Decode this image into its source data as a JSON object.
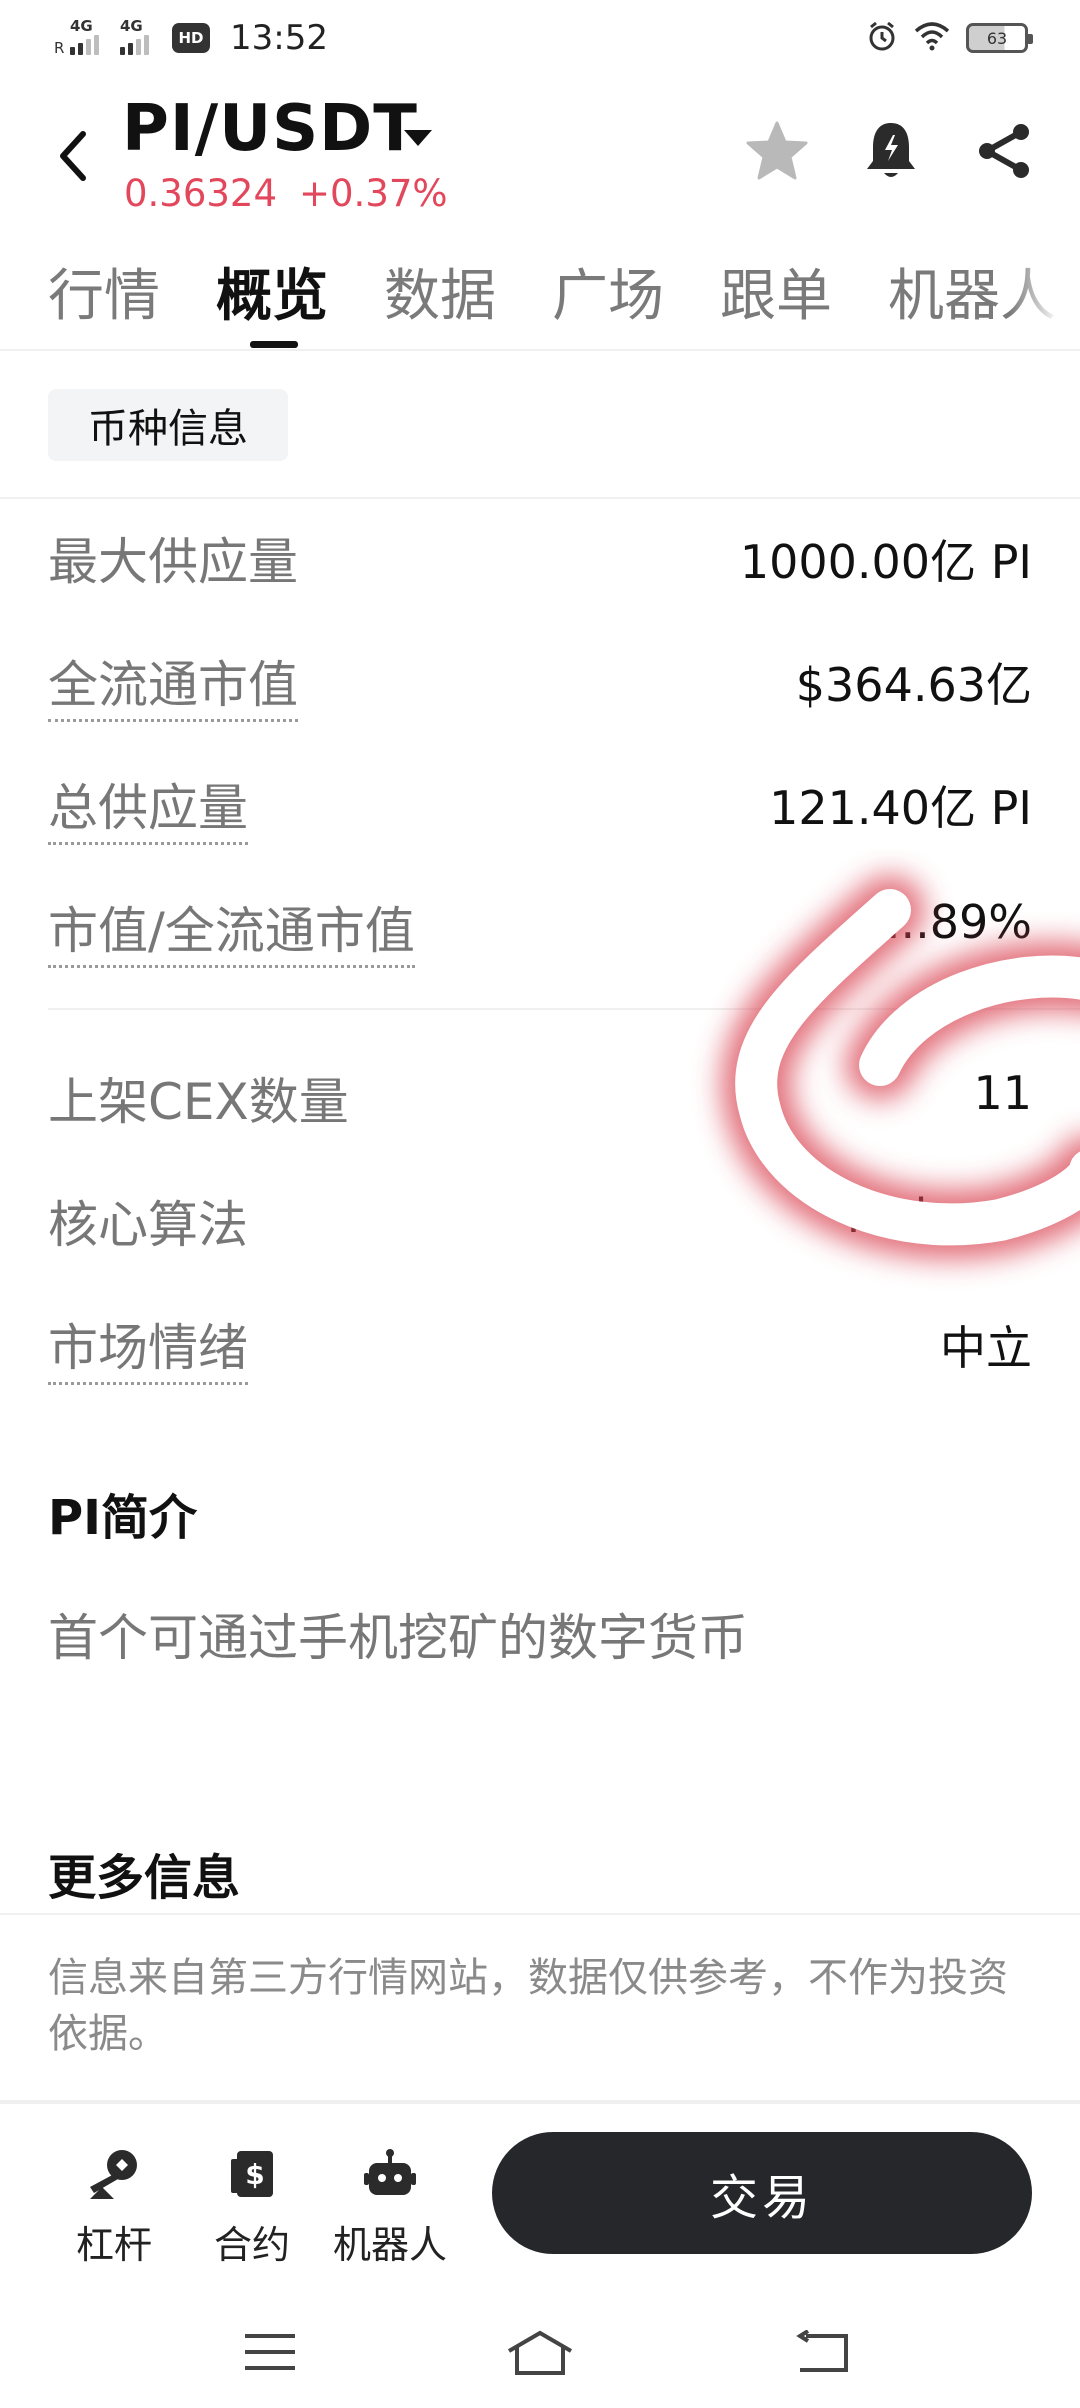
{
  "status_bar": {
    "network_1": "4G",
    "network_1_roaming": "R",
    "network_2": "4G",
    "hd_badge": "HD",
    "time": "13:52",
    "battery": "63",
    "icons": [
      "alarm-icon",
      "wifi-icon",
      "battery-icon"
    ]
  },
  "header": {
    "pair": "PI/USDT",
    "price": "0.36324",
    "change": "+0.37%",
    "price_color": "#e2475b",
    "icons": [
      "back-icon",
      "caret-down-icon",
      "star-icon",
      "bell-icon",
      "share-icon"
    ]
  },
  "tabs": {
    "items": [
      "行情",
      "概览",
      "数据",
      "广场",
      "跟单",
      "机器人"
    ],
    "active": "概览"
  },
  "coin_info": {
    "chip": "币种信息",
    "rows": [
      {
        "label": "最大供应量",
        "value": "1000.00亿 PI"
      },
      {
        "label": "全流通市值",
        "value": "$364.63亿"
      },
      {
        "label": "总供应量",
        "value": "121.40亿 PI"
      },
      {
        "label": "市值/全流通市值",
        "value": "...89%"
      },
      {
        "label": "上架CEX数量",
        "value": "11"
      },
      {
        "label": "核心算法",
        "value": "Mainnet"
      },
      {
        "label": "市场情绪",
        "value": "中立"
      }
    ]
  },
  "intro": {
    "title": "PI简介",
    "text": "首个可通过手机挖矿的数字货币"
  },
  "more_info": {
    "title": "更多信息",
    "disclaimer": "信息来自第三方行情网站，数据仅供参考，不作为投资依据。"
  },
  "bottom_bar": {
    "actions": [
      {
        "label": "杠杆",
        "icon": "leverage-icon"
      },
      {
        "label": "合约",
        "icon": "contract-icon"
      },
      {
        "label": "机器人",
        "icon": "robot-icon"
      }
    ],
    "trade": "交易"
  },
  "system_nav": [
    "menu-icon",
    "home-icon",
    "back-icon"
  ]
}
